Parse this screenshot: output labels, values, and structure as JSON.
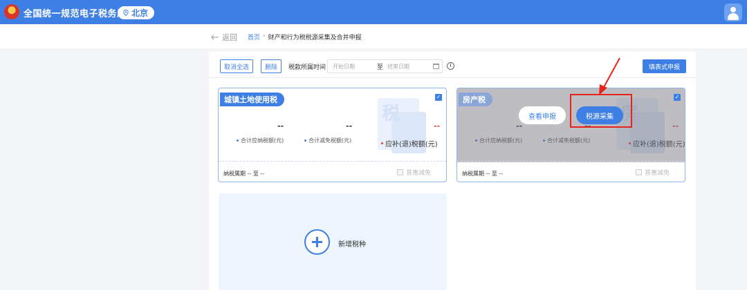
{
  "header": {
    "site_title": "全国统一规范电子税务局",
    "region": "北京"
  },
  "subbar": {
    "back_label": "返回",
    "breadcrumb": {
      "home": "首页",
      "current": "财产和行为税税源采集及合并申报"
    }
  },
  "toolbar": {
    "deselect_all": "取消全选",
    "delete": "删除",
    "period_label": "税款所属时间",
    "start_placeholder": "开始日期",
    "range_separator": "至",
    "end_placeholder": "结束日期",
    "form_filing": "填表式申报"
  },
  "cards": [
    {
      "tax_name": "城镇土地使用税",
      "checked": true,
      "payable_value": "--",
      "reduction_value": "--",
      "refund_value": "--",
      "payable_label": "合计应纳税额(元)",
      "reduction_label": "合计减免税额(元)",
      "refund_label": "应补(退)税额(元)",
      "period": "纳税属期 -- 至 --",
      "exempt_label": "普惠减免"
    },
    {
      "tax_name": "房产税",
      "checked": true,
      "payable_value": "--",
      "reduction_value": "--",
      "refund_value": "--",
      "payable_label": "合计应纳税额(元)",
      "reduction_label": "合计减免税额(元)",
      "refund_label": "应补(退)税额(元)",
      "period": "纳税属期 -- 至 --",
      "exempt_label": "普惠减免",
      "view_filing": "查看申报",
      "source_collect": "税源采集"
    }
  ],
  "add_card": {
    "label": "新增税种"
  },
  "colors": {
    "primary": "#3d7fe4",
    "annotation": "#e8231b",
    "negative": "#e53935"
  }
}
